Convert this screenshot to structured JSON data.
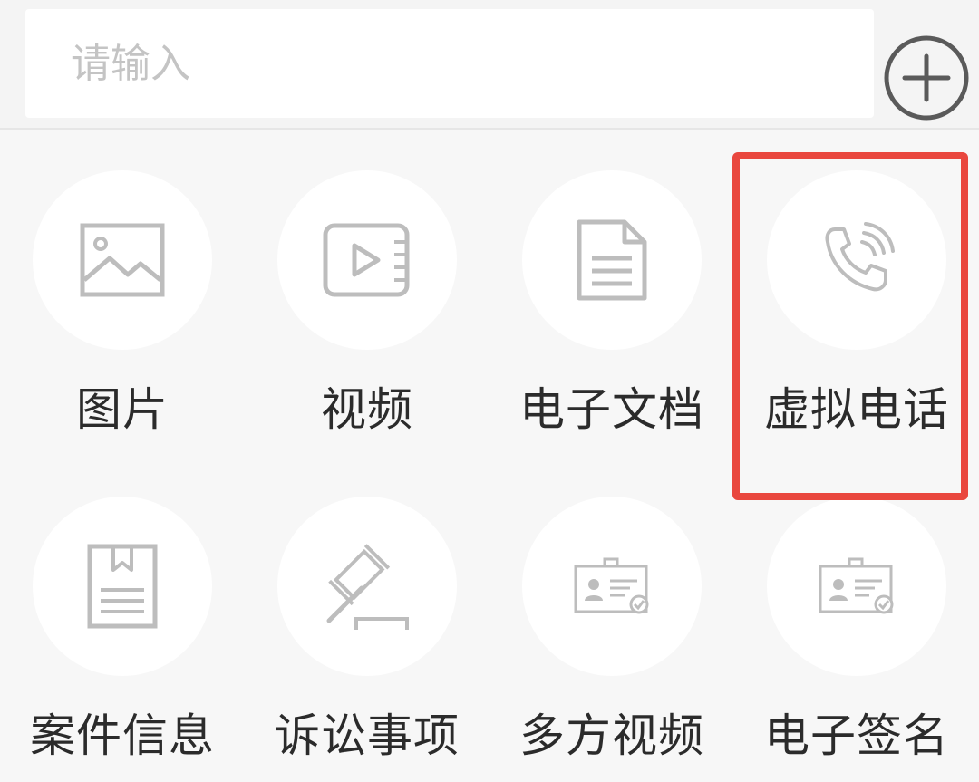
{
  "search": {
    "placeholder": "请输入",
    "add_icon": "plus-circle-icon"
  },
  "colors": {
    "icon_gray": "#bdbdbd",
    "highlight_red": "#e9473e",
    "label_text": "#2b2b2b",
    "placeholder_text": "#c4c4c4"
  },
  "grid": {
    "items": [
      {
        "label": "图片",
        "icon": "image-icon"
      },
      {
        "label": "视频",
        "icon": "video-icon"
      },
      {
        "label": "电子文档",
        "icon": "document-icon"
      },
      {
        "label": "虚拟电话",
        "icon": "phone-call-icon",
        "highlighted": true
      },
      {
        "label": "案件信息",
        "icon": "case-book-icon"
      },
      {
        "label": "诉讼事项",
        "icon": "gavel-icon"
      },
      {
        "label": "多方视频",
        "icon": "id-card-check-icon"
      },
      {
        "label": "电子签名",
        "icon": "id-card-check-icon"
      }
    ]
  }
}
